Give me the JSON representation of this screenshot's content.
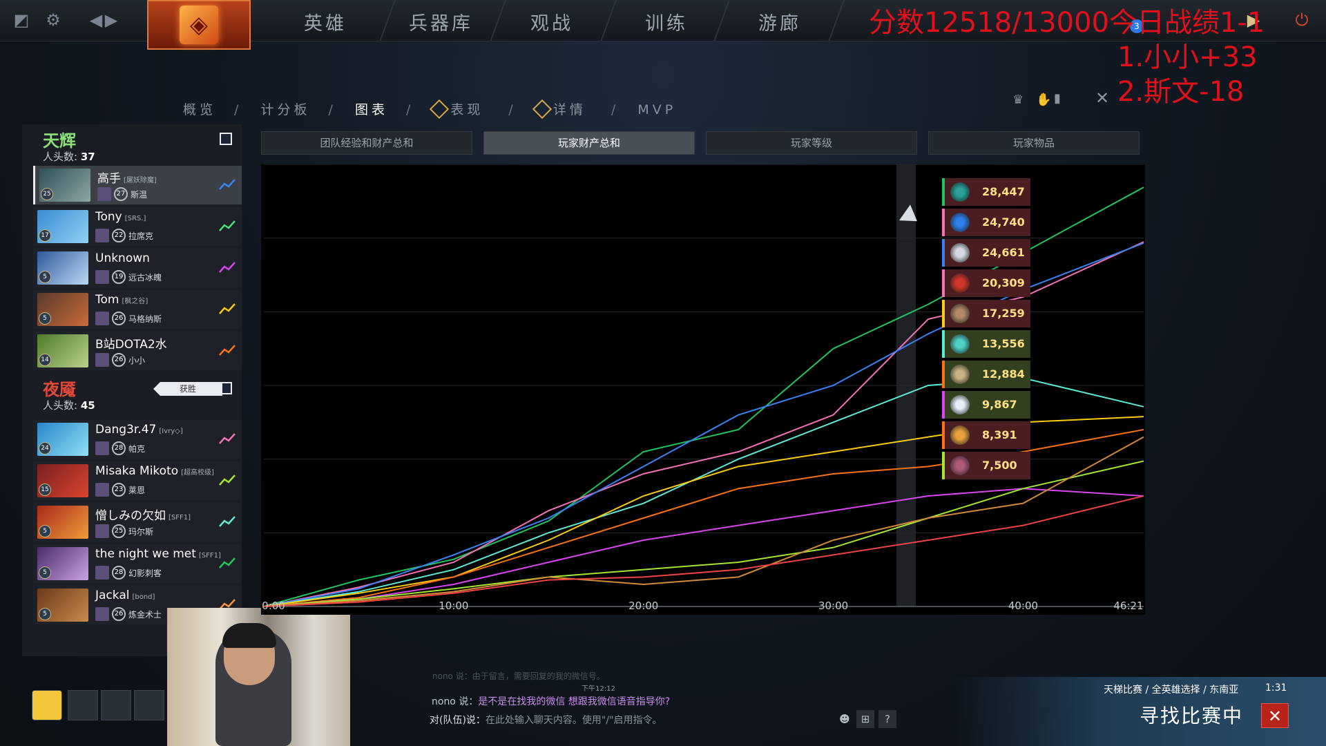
{
  "nav": {
    "items": [
      "英雄",
      "兵器库",
      "观战",
      "训练",
      "游廊"
    ]
  },
  "overlay": {
    "score": "分数12518/13000今日战绩1-1",
    "line1": "1.小小+33",
    "line2": "2.斯文-18",
    "badge_count": "3"
  },
  "subnav": {
    "items": [
      "概览",
      "计分板",
      "图表",
      "表现",
      "详情",
      "MVP"
    ],
    "active": "图表"
  },
  "radiant": {
    "name": "天辉",
    "kills_label": "人头数:",
    "kills": "37",
    "players": [
      {
        "name": "高手",
        "tag": "[屠妖除魔]",
        "level": "27",
        "hero": "斯温",
        "hero_level": "25",
        "trend_color": "#3b82f6"
      },
      {
        "name": "Tony",
        "tag": "[SRS.]",
        "level": "22",
        "hero": "拉席克",
        "hero_level": "17",
        "trend_color": "#4ade80"
      },
      {
        "name": "Unknown",
        "tag": "",
        "level": "19",
        "hero": "远古冰魄",
        "hero_level": "5",
        "trend_color": "#d946ef"
      },
      {
        "name": "Tom",
        "tag": "[枫之谷]",
        "level": "26",
        "hero": "马格纳斯",
        "hero_level": "5",
        "trend_color": "#facc15"
      },
      {
        "name": "B站DOTA2水",
        "tag": "",
        "level": "26",
        "hero": "小小",
        "hero_level": "14",
        "trend_color": "#f97316"
      }
    ]
  },
  "dire": {
    "name": "夜魇",
    "kills_label": "人头数:",
    "kills": "45",
    "win_label": "获胜",
    "players": [
      {
        "name": "Dang3r.47",
        "tag": "[Ivry◇]",
        "level": "28",
        "hero": "帕克",
        "hero_level": "24",
        "trend_color": "#f472b6"
      },
      {
        "name": "Misaka Mikoto",
        "tag": "[超高校级]",
        "level": "23",
        "hero": "莱恩",
        "hero_level": "15",
        "trend_color": "#a3e635"
      },
      {
        "name": "憎しみの欠如",
        "tag": "[SFF1]",
        "level": "25",
        "hero": "玛尔斯",
        "hero_level": "5",
        "trend_color": "#5eead4"
      },
      {
        "name": "the night we met",
        "tag": "[SFF1]",
        "level": "28",
        "hero": "幻影刺客",
        "hero_level": "5",
        "trend_color": "#22c55e"
      },
      {
        "name": "Jackal",
        "tag": "[bond]",
        "level": "26",
        "hero": "炼金术士",
        "hero_level": "5",
        "trend_color": "#fb923c"
      }
    ]
  },
  "graph_tabs": [
    "团队经验和财产总和",
    "玩家财产总和",
    "玩家等级",
    "玩家物品"
  ],
  "graph_tab_active": 1,
  "chart_data": {
    "type": "line",
    "title": "",
    "xlabel": "",
    "ylabel": "",
    "x_ticks": [
      "0:00",
      "10:00",
      "20:00",
      "30:00",
      "40:00",
      "46:21"
    ],
    "x_minutes": [
      0,
      5,
      10,
      15,
      20,
      25,
      30,
      35,
      40,
      46.35
    ],
    "ylim": [
      0,
      30000
    ],
    "grid": true,
    "series": [
      {
        "color": "#22c55e",
        "values": [
          0,
          1800,
          3200,
          5800,
          10500,
          12000,
          17500,
          20500,
          24000,
          28447
        ]
      },
      {
        "color": "#f472b6",
        "values": [
          0,
          1300,
          3000,
          6500,
          9000,
          10500,
          13000,
          19500,
          21000,
          24740
        ]
      },
      {
        "color": "#3b82f6",
        "values": [
          0,
          1200,
          3500,
          6000,
          9500,
          13000,
          15000,
          18500,
          21500,
          24661
        ]
      },
      {
        "color": "#5eead4",
        "values": [
          0,
          1000,
          2500,
          5000,
          7000,
          10000,
          12500,
          15000,
          15500,
          13556
        ]
      },
      {
        "color": "#facc15",
        "values": [
          0,
          900,
          2000,
          4500,
          7500,
          9500,
          10500,
          11500,
          12500,
          12884
        ]
      },
      {
        "color": "#f97316",
        "values": [
          0,
          600,
          2000,
          4000,
          6000,
          8000,
          9000,
          9500,
          10500,
          12000
        ]
      },
      {
        "color": "#d946ef",
        "values": [
          0,
          500,
          1500,
          3000,
          4500,
          5500,
          6500,
          7500,
          8000,
          7500
        ]
      },
      {
        "color": "#a3e635",
        "values": [
          0,
          500,
          1200,
          2000,
          2500,
          3000,
          4000,
          6000,
          8000,
          9867
        ]
      },
      {
        "color": "#d08a3a",
        "values": [
          0,
          400,
          1000,
          2000,
          1500,
          2000,
          4500,
          6000,
          7000,
          11500
        ]
      },
      {
        "color": "#ef4444",
        "values": [
          0,
          300,
          900,
          1800,
          2000,
          2500,
          3500,
          4500,
          5500,
          7500
        ]
      }
    ]
  },
  "legend": [
    {
      "value": "28,447",
      "bar": "#22c55e",
      "bg": "#4a1d20",
      "hero": "#2aa198"
    },
    {
      "value": "24,740",
      "bar": "#f472b6",
      "bg": "#4a1d20",
      "hero": "#2f80ed"
    },
    {
      "value": "24,661",
      "bar": "#3b82f6",
      "bg": "#4a1d20",
      "hero": "#d6dbe3"
    },
    {
      "value": "20,309",
      "bar": "#f472b6",
      "bg": "#4a1d20",
      "hero": "#d2362a"
    },
    {
      "value": "17,259",
      "bar": "#facc15",
      "bg": "#4a1d20",
      "hero": "#b58a6a"
    },
    {
      "value": "13,556",
      "bar": "#5eead4",
      "bg": "#33401f",
      "hero": "#4fd1c5"
    },
    {
      "value": "12,884",
      "bar": "#f97316",
      "bg": "#33401f",
      "hero": "#c9b382"
    },
    {
      "value": "9,867",
      "bar": "#d946ef",
      "bg": "#33401f",
      "hero": "#e6eef7"
    },
    {
      "value": "8,391",
      "bar": "#f97316",
      "bg": "#4a1d20",
      "hero": "#e8a13c"
    },
    {
      "value": "7,500",
      "bar": "#a3e635",
      "bg": "#4a1d20",
      "hero": "#b05a7a"
    }
  ],
  "chat": {
    "faded": "nono 说：由于留言，需要回复的我的微信号。",
    "time": "下午12:12",
    "line1_user": "nono 说：",
    "line1_msg": "是不是在找我的微信 想跟我微信语音指导你?",
    "line2_prefix": "对(队伍)说：",
    "line2_placeholder": "在此处输入聊天内容。使用\"/\"启用指令。",
    "btn_help": "?"
  },
  "matchmaking": {
    "meta": "天梯比赛 / 全英雄选择 / 东南亚",
    "time": "1:31",
    "status": "寻找比赛中",
    "cancel": "✕"
  }
}
